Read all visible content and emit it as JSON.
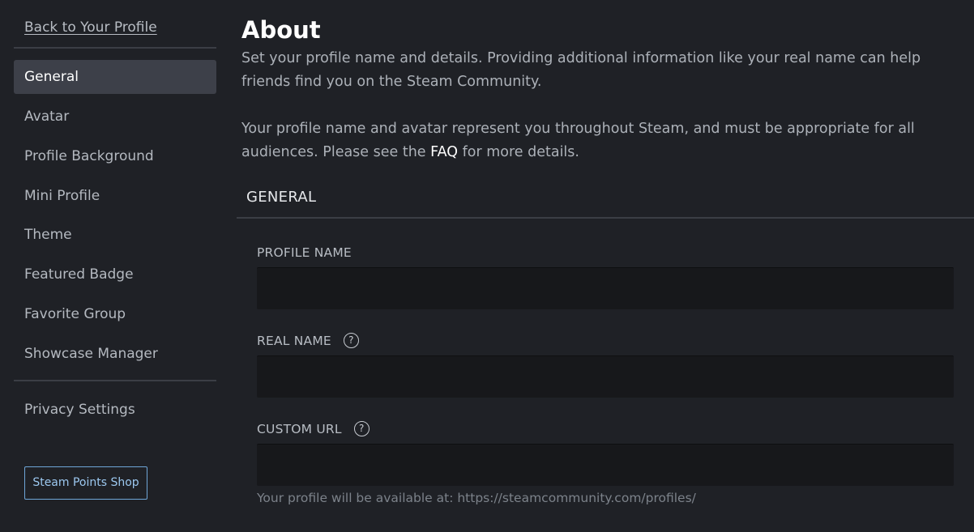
{
  "sidebar": {
    "back_link": "Back to Your Profile",
    "items": [
      {
        "label": "General"
      },
      {
        "label": "Avatar"
      },
      {
        "label": "Profile Background"
      },
      {
        "label": "Mini Profile"
      },
      {
        "label": "Theme"
      },
      {
        "label": "Featured Badge"
      },
      {
        "label": "Favorite Group"
      },
      {
        "label": "Showcase Manager"
      }
    ],
    "active_item": "General",
    "privacy": {
      "label": "Privacy Settings"
    },
    "points_shop_button": "Steam Points Shop"
  },
  "main": {
    "title": "About",
    "description_1": "Set your profile name and details. Providing additional information like your real name can help friends find you on the Steam Community.",
    "description_2_before": "Your profile name and avatar represent you throughout Steam, and must be appropriate for all audiences. Please see the ",
    "faq_link": "FAQ",
    "description_2_after": " for more details.",
    "section_title": "GENERAL",
    "fields": {
      "profile_name": {
        "label": "PROFILE NAME",
        "value": ""
      },
      "real_name": {
        "label": "REAL NAME",
        "value": "",
        "help": "?"
      },
      "custom_url": {
        "label": "CUSTOM URL",
        "value": "",
        "help": "?"
      }
    },
    "url_note": "Your profile will be available at: https://steamcommunity.com/profiles/"
  },
  "colors": {
    "background": "#1f2126",
    "active_nav": "#3d4049",
    "input_bg": "#17181b",
    "button_border": "#6fa6d8",
    "button_text": "#9cc8f0"
  }
}
